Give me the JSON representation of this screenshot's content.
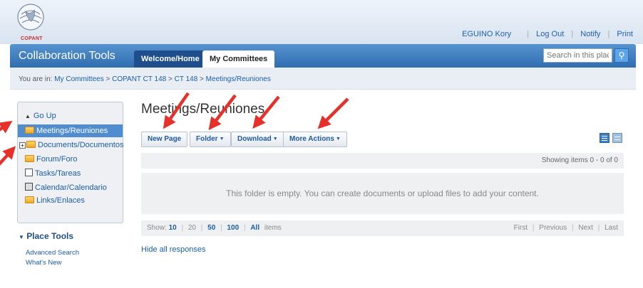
{
  "header": {
    "logo_text": "COPANT",
    "user_name": "EGUINO Kory",
    "links": [
      "Log Out",
      "Notify",
      "Print"
    ]
  },
  "navbar": {
    "app_title": "Collaboration Tools",
    "tabs": [
      "Welcome/Home",
      "My Committees"
    ],
    "active_tab": "My Committees",
    "search_placeholder": "Search in this place"
  },
  "breadcrumb": {
    "prefix": "You are in:",
    "items": [
      "My Committees",
      "COPANT CT 148",
      "CT 148",
      "Meetings/Reuniones"
    ],
    "separator": ">"
  },
  "sidebar": {
    "go_up": "Go Up",
    "items": [
      {
        "label": "Meetings/Reuniones",
        "icon": "folder-icon",
        "selected": true
      },
      {
        "label": "Documents/Documentos",
        "icon": "folder-icon",
        "expandable": true
      },
      {
        "label": "Forum/Foro",
        "icon": "folder-icon"
      },
      {
        "label": "Tasks/Tareas",
        "icon": "tasks-icon"
      },
      {
        "label": "Calendar/Calendario",
        "icon": "calendar-icon"
      },
      {
        "label": "Links/Enlaces",
        "icon": "folder-icon"
      }
    ],
    "place_tools_title": "Place Tools",
    "place_tools_links": [
      "Advanced Search",
      "What's New"
    ]
  },
  "main": {
    "title": "Meetings/Reuniones",
    "toolbar": {
      "new_page": "New Page",
      "folder": "Folder",
      "download": "Download",
      "more_actions": "More Actions"
    },
    "showing_text": "Showing items 0 - 0 of 0",
    "empty_message": "This folder is empty. You can create documents or upload files to add your content.",
    "pager": {
      "show_label": "Show:",
      "sizes": [
        "10",
        "20",
        "50",
        "100",
        "All"
      ],
      "items_label": "items",
      "nav": [
        "First",
        "Previous",
        "Next",
        "Last"
      ]
    },
    "hide_responses": "Hide all responses"
  },
  "colors": {
    "navbar": "#2f6db0",
    "link": "#1a5ea8",
    "selected": "#4f8dd0",
    "arrow": "#e8302a"
  }
}
